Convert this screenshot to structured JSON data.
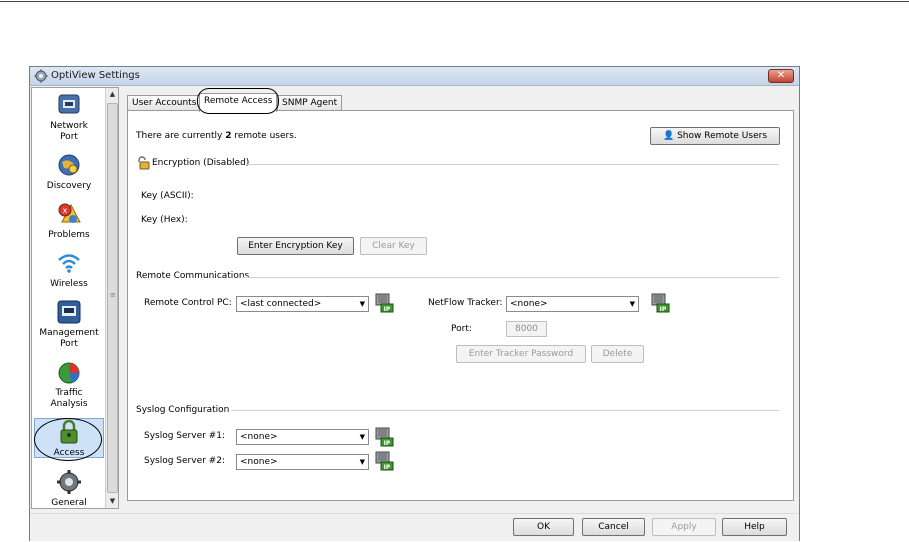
{
  "window": {
    "title": "OptiView Settings",
    "close_glyph": "✕"
  },
  "sidebar": {
    "items": [
      {
        "label": "Network\nPort",
        "icon": "network-port-icon"
      },
      {
        "label": "Discovery",
        "icon": "discovery-icon"
      },
      {
        "label": "Problems",
        "icon": "problems-icon"
      },
      {
        "label": "Wireless",
        "icon": "wireless-icon"
      },
      {
        "label": "Management\nPort",
        "icon": "management-port-icon"
      },
      {
        "label": "Traffic\nAnalysis",
        "icon": "traffic-analysis-icon"
      },
      {
        "label": "Access",
        "icon": "access-lock-icon",
        "selected": true
      },
      {
        "label": "General",
        "icon": "general-gear-icon"
      }
    ]
  },
  "tabs": [
    {
      "label": "User Accounts"
    },
    {
      "label": "Remote Access",
      "active": true
    },
    {
      "label": "SNMP Agent"
    }
  ],
  "remote_access": {
    "users_prefix": "There are currently ",
    "users_count": "2",
    "users_suffix": " remote users.",
    "show_users_button": "Show Remote Users",
    "encryption_header": "Encryption (Disabled)",
    "key_ascii_label": "Key (ASCII):",
    "key_hex_label": "Key (Hex):",
    "enter_key_button": "Enter Encryption Key",
    "clear_key_button": "Clear Key",
    "remote_comm_header": "Remote Communications",
    "remote_control_label": "Remote Control PC:",
    "remote_control_value": "<last connected>",
    "netflow_label": "NetFlow Tracker:",
    "netflow_value": "<none>",
    "port_label": "Port:",
    "port_value": "8000",
    "tracker_password_button": "Enter Tracker Password",
    "delete_button": "Delete",
    "syslog_header": "Syslog Configuration",
    "syslog1_label": "Syslog Server #1:",
    "syslog1_value": "<none>",
    "syslog2_label": "Syslog Server #2:",
    "syslog2_value": "<none>"
  },
  "footer": {
    "ok": "OK",
    "cancel": "Cancel",
    "apply": "Apply",
    "help": "Help"
  }
}
